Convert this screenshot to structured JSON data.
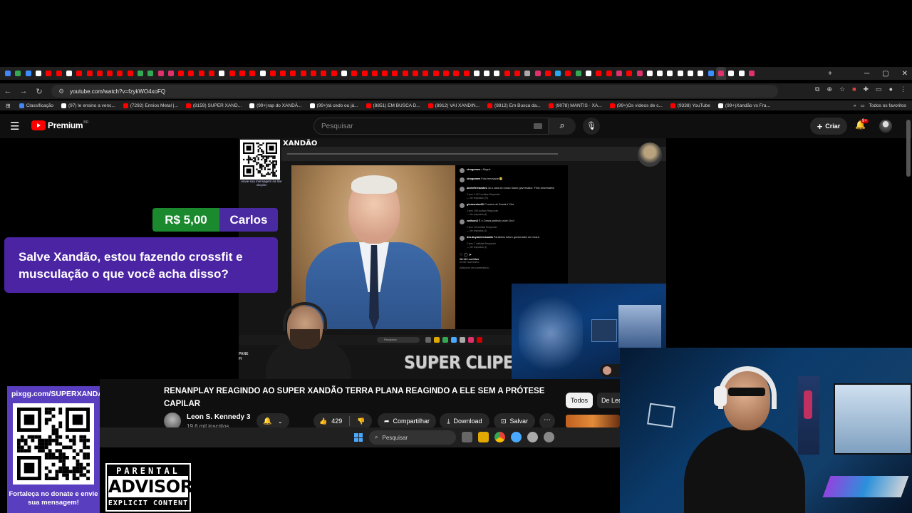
{
  "browser": {
    "url": "youtube.com/watch?v=fzykWO4xoFQ",
    "tab_colors": [
      "#4285f4",
      "#34a853",
      "#3c8dff",
      "#ffffff",
      "#ff0000",
      "#ff0000",
      "#ffffff",
      "#ff0000",
      "#ff0000",
      "#ff0000",
      "#ff0000",
      "#ff0000",
      "#ff0000",
      "#34a853",
      "#34a853",
      "#e1306c",
      "#e1306c",
      "#ff0000",
      "#ff0000",
      "#ff0000",
      "#ff0000",
      "#ffffff",
      "#ff0000",
      "#ff0000",
      "#ff0000",
      "#ffffff",
      "#ff0000",
      "#ff0000",
      "#ff0000",
      "#ff0000",
      "#ff0000",
      "#ff0000",
      "#ff0000",
      "#ffffff",
      "#ff0000",
      "#ff0000",
      "#ff0000",
      "#ff0000",
      "#ff0000",
      "#ff0000",
      "#ff0000",
      "#ff0000",
      "#ff0000",
      "#ff0000",
      "#ff0000",
      "#ff0000",
      "#ffffff",
      "#ffffff",
      "#ffffff",
      "#ff0000",
      "#ff0000",
      "#aaaaaa",
      "#e1306c",
      "#ff0000",
      "#29a9eb",
      "#ff0000",
      "#34a853",
      "#ffffff",
      "#ff0000",
      "#ff0000",
      "#e1306c",
      "#ff0000",
      "#e1306c",
      "#ffffff",
      "#ffffff",
      "#ffffff",
      "#ffffff",
      "#ffffff",
      "#ffffff",
      "#3c8dff",
      "#e1306c",
      "#ffffff",
      "#ffffff",
      "#e1306c"
    ],
    "bookmarks": [
      {
        "label": "Classificação",
        "color": "#4285f4"
      },
      {
        "label": "(97) le ensino a venc...",
        "color": "#ffffff"
      },
      {
        "label": "(7292) Ennios Metal |...",
        "color": "#ff0000"
      },
      {
        "label": "(8159) SUPER XAND...",
        "color": "#ff0000"
      },
      {
        "label": "(99+)rap do XANDÃ...",
        "color": "#ffffff"
      },
      {
        "label": "(99+)tá cedo ou já...",
        "color": "#ffffff"
      },
      {
        "label": "(8851) EM BUSCA D...",
        "color": "#ff0000"
      },
      {
        "label": "(8912) VAI XANDIN...",
        "color": "#ff0000"
      },
      {
        "label": "(8912) Em Busca da...",
        "color": "#ff0000"
      },
      {
        "label": "(9078) MANTIS · XA...",
        "color": "#ff0000"
      },
      {
        "label": "(99+)Os vídeos de c...",
        "color": "#ff0000"
      },
      {
        "label": "(9338) YouTube",
        "color": "#ff0000"
      },
      {
        "label": "(99+)Xandão vs Fra...",
        "color": "#ffffff"
      }
    ],
    "all_bookmarks": "Todos os favoritos"
  },
  "youtube": {
    "logo_text": "Premium",
    "logo_region": "BR",
    "search_placeholder": "Pesquisar",
    "create_label": "Criar",
    "notif_count": "9+"
  },
  "video": {
    "overlay_title": "XANDÃO",
    "qr_caption": "envie sua mensagem na live via pix!",
    "super_clipes": "SUPER CLIPES",
    "pane_text": "PANE\nFI",
    "inner_taskbar_search": "Pesquisar",
    "instagram": {
      "header_user": "cirogomes",
      "follow": "• Seguir",
      "caption": "Foto renovada 😁",
      "comments": [
        {
          "user": "andrefernandes",
          "text": "Já a cara do nosso futuro governador. Feliz aniversário!",
          "meta": "2 sem.  1.007 curtidas  Responder",
          "replies": "Ver respostas (70)"
        },
        {
          "user": "giomoreira26",
          "text": "O nome do Ceará é Ciro",
          "meta": "2 sem.  295 curtidas  Responder",
          "replies": "Ver respostas (4)"
        },
        {
          "user": "zwilson3",
          "text": "É o Ceará pedindo você Ciro!",
          "meta": "2 sem.  39 curtidas  Responder",
          "replies": "Ver respostas (1)"
        },
        {
          "user": "dra.duyanemesuada",
          "text": "Parabéns futuro governador do Ceará",
          "meta": "2 sem.  7 curtidas  Responder",
          "replies": "Ver respostas (1)"
        }
      ],
      "likes": "28.113 curtidas",
      "date": "24 de novembro",
      "add_comment": "Adicione um comentário..."
    }
  },
  "superchat": {
    "amount": "R$ 5,00",
    "name": "Carlos",
    "message": "Salve Xandão, estou fazendo crossfit e musculação o que você acha disso?"
  },
  "watch": {
    "title": "RENANPLAY REAGINDO AO SUPER XANDÃO TERRA PLANA REAGINDO A ELE SEM A PRÓTESE CAPILAR",
    "channel": "Leon S. Kennedy 3",
    "subscribers": "19,6 mil inscritos",
    "likes": "429",
    "share": "Compartilhar",
    "download": "Download",
    "save": "Salvar",
    "chip_all": "Todos",
    "chip_next": "De Leon"
  },
  "taskbar": {
    "search": "Pesquisar"
  },
  "pix": {
    "url": "pixgg.com/SUPERXANDAO",
    "caption": "Fortaleça no donate e envie sua mensagem!"
  },
  "parental_advisory": {
    "top": "PARENTAL",
    "mid": "ADVISORY",
    "bottom": "EXPLICIT CONTENT"
  }
}
